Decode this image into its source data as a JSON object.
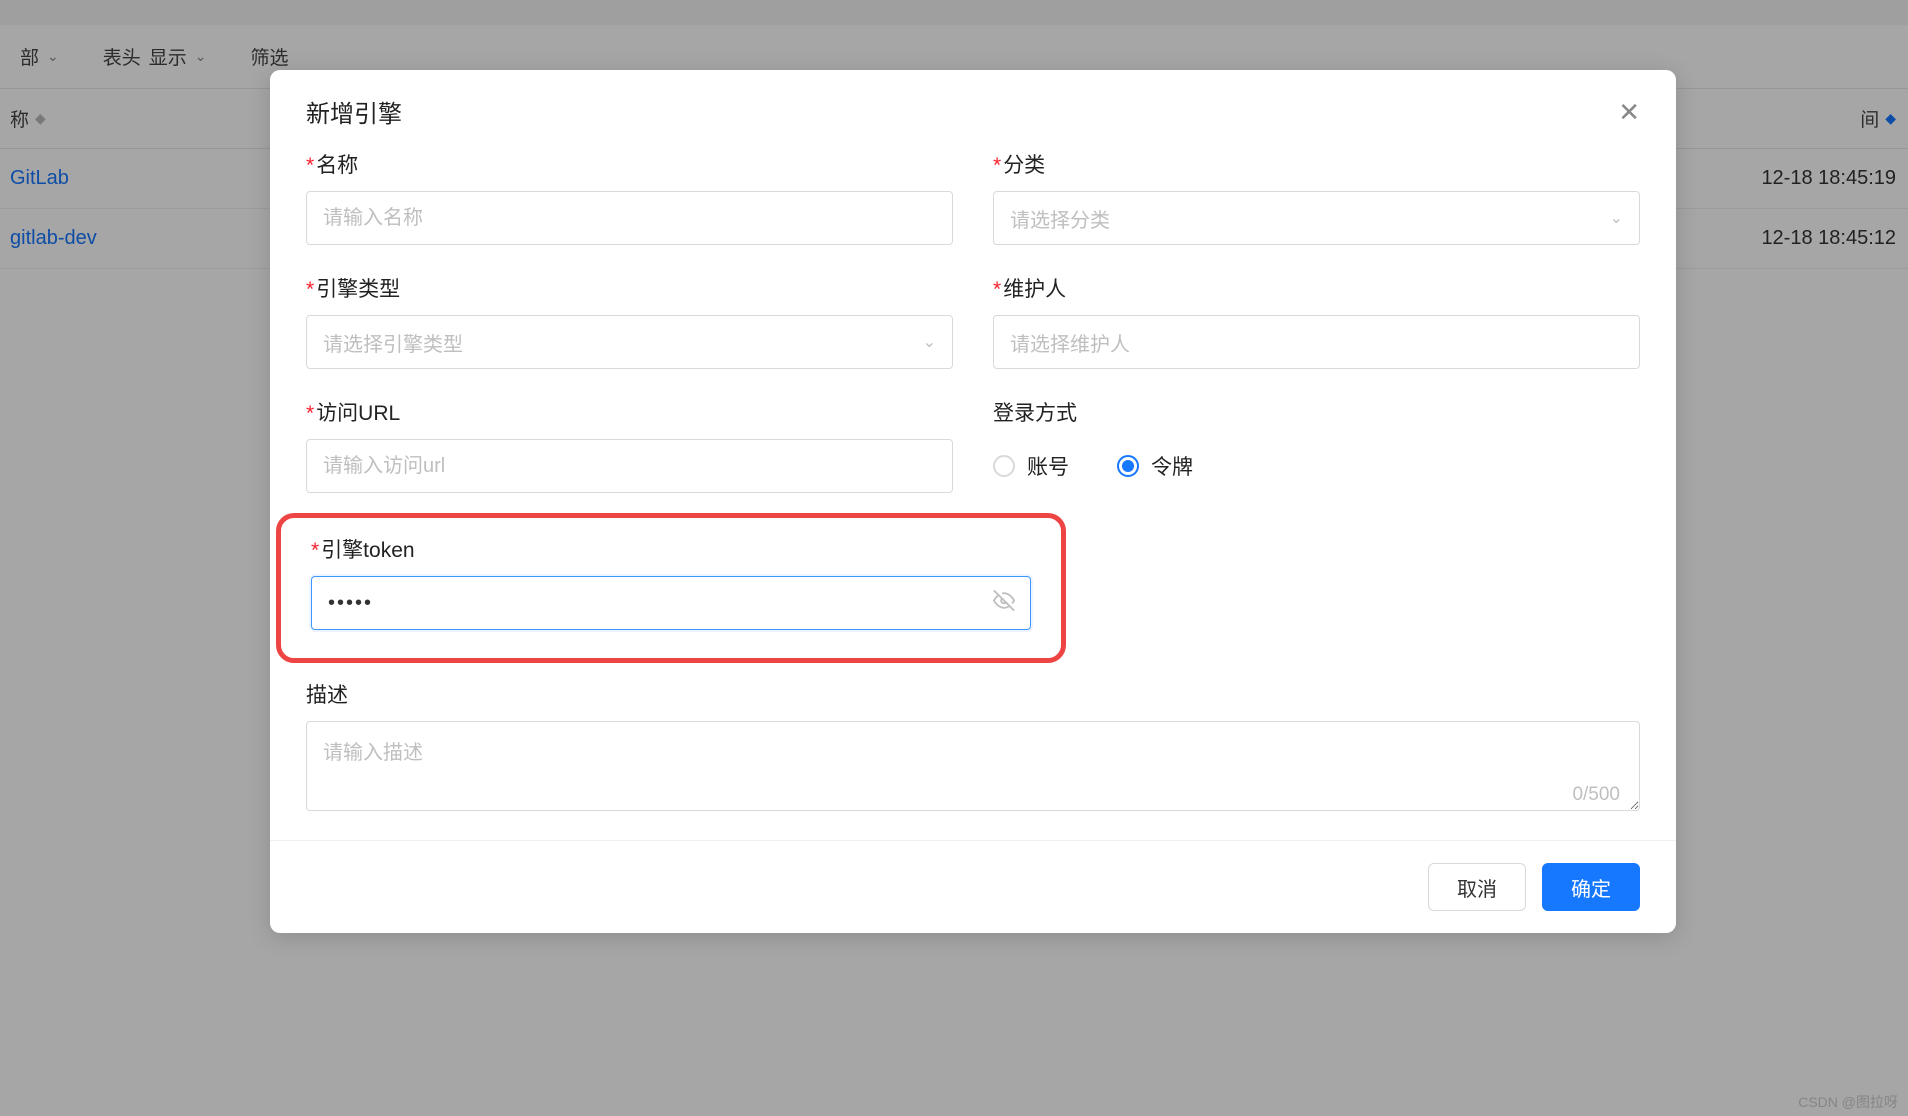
{
  "background": {
    "filter": {
      "all_suffix": "部",
      "header_prefix": "表头",
      "header_display": "显示",
      "filter_label": "筛选"
    },
    "table": {
      "col_name_suffix": "称",
      "col_time_suffix": "间",
      "rows": [
        {
          "name": "GitLab",
          "time": "12-18 18:45:19"
        },
        {
          "name": "gitlab-dev",
          "time": "12-18 18:45:12"
        }
      ]
    }
  },
  "modal": {
    "title": "新增引擎",
    "fields": {
      "name": {
        "label": "名称",
        "placeholder": "请输入名称"
      },
      "category": {
        "label": "分类",
        "placeholder": "请选择分类"
      },
      "engine_type": {
        "label": "引擎类型",
        "placeholder": "请选择引擎类型"
      },
      "maintainer": {
        "label": "维护人",
        "placeholder": "请选择维护人"
      },
      "url": {
        "label": "访问URL",
        "placeholder": "请输入访问url"
      },
      "login_method": {
        "label": "登录方式",
        "options": {
          "account": "账号",
          "token": "令牌"
        },
        "selected": "token"
      },
      "engine_token": {
        "label": "引擎token",
        "value": "•••••"
      },
      "description": {
        "label": "描述",
        "placeholder": "请输入描述",
        "char_count": "0/500"
      }
    },
    "buttons": {
      "cancel": "取消",
      "confirm": "确定"
    }
  },
  "watermark": "CSDN @图拉呀"
}
